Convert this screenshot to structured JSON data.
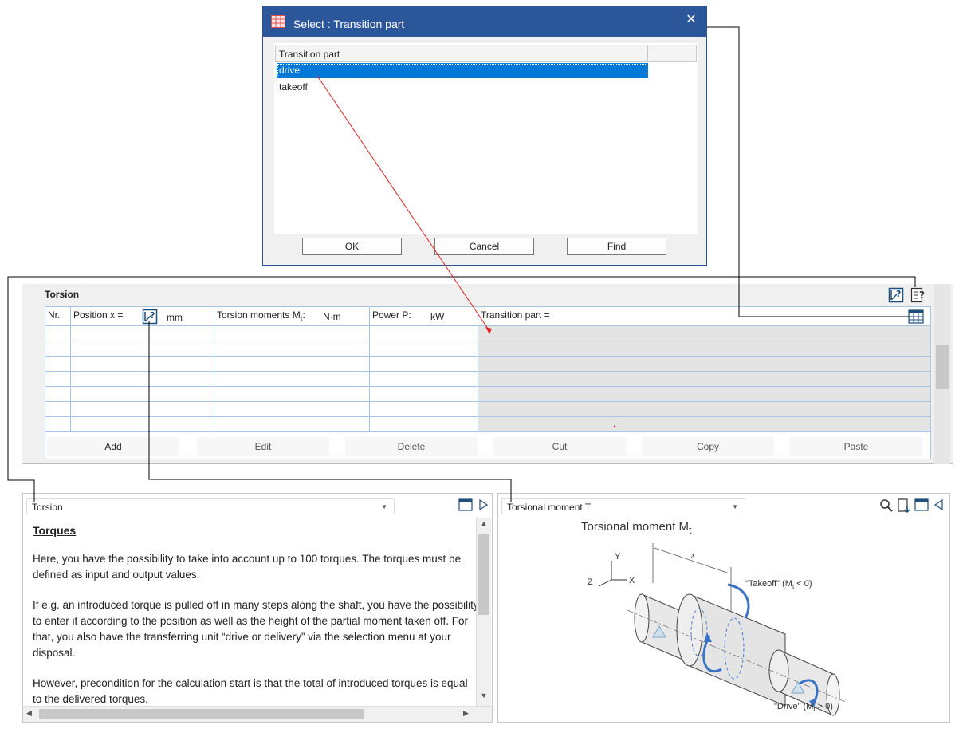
{
  "dialog": {
    "title": "Select : Transition part",
    "close": "✕",
    "column_header": "Transition part",
    "items": [
      "drive",
      "takeoff"
    ],
    "selected": "drive",
    "buttons": {
      "ok": "OK",
      "cancel": "Cancel",
      "find": "Find"
    }
  },
  "torsion": {
    "title": "Torsion",
    "columns": {
      "nr": "Nr.",
      "position": "Position x =",
      "position_unit": "mm",
      "moments": "Torsion moments M",
      "moments_sub": "t",
      "moments_colon": ":",
      "moments_unit": "N·m",
      "power": "Power P:",
      "power_unit": "kW",
      "transition": "Transition  part ="
    },
    "buttons": {
      "add": "Add",
      "edit": "Edit",
      "delete": "Delete",
      "cut": "Cut",
      "copy": "Copy",
      "paste": "Paste"
    }
  },
  "help_pane": {
    "selector": "Torsion",
    "heading": "Torques",
    "paragraphs": [
      "Here, you have the possibility to take into account up to 100 torques. The torques must be defined as input and output values.",
      "If e.g. an introduced torque is pulled off in many steps along the shaft, you have the possibility to enter it according to the position as well as the height of the partial moment taken off. For that, you also have the transferring unit “drive or delivery” via the selection menu at your disposal.",
      "However, precondition for the calculation start is that the total of introduced torques is equal to the delivered torques."
    ]
  },
  "graphic_pane": {
    "selector": "Torsional moment T",
    "diagram_title": "Torsional moment M",
    "diagram_title_sub": "t",
    "labels": {
      "takeoff": "\"Takeoff\" (M",
      "takeoff_sub": "t",
      "takeoff_cond": " < 0)",
      "drive": "\"Drive\" (M",
      "drive_sub": "t",
      "drive_cond": " > 0)",
      "x": "x",
      "axis_x": "X",
      "axis_y": "Y",
      "axis_z": "Z"
    }
  },
  "colors": {
    "accent": "#2b579a",
    "selection": "#0078d7",
    "grid_line": "#a9c4e2",
    "arrow_blue": "#3a73c4"
  }
}
